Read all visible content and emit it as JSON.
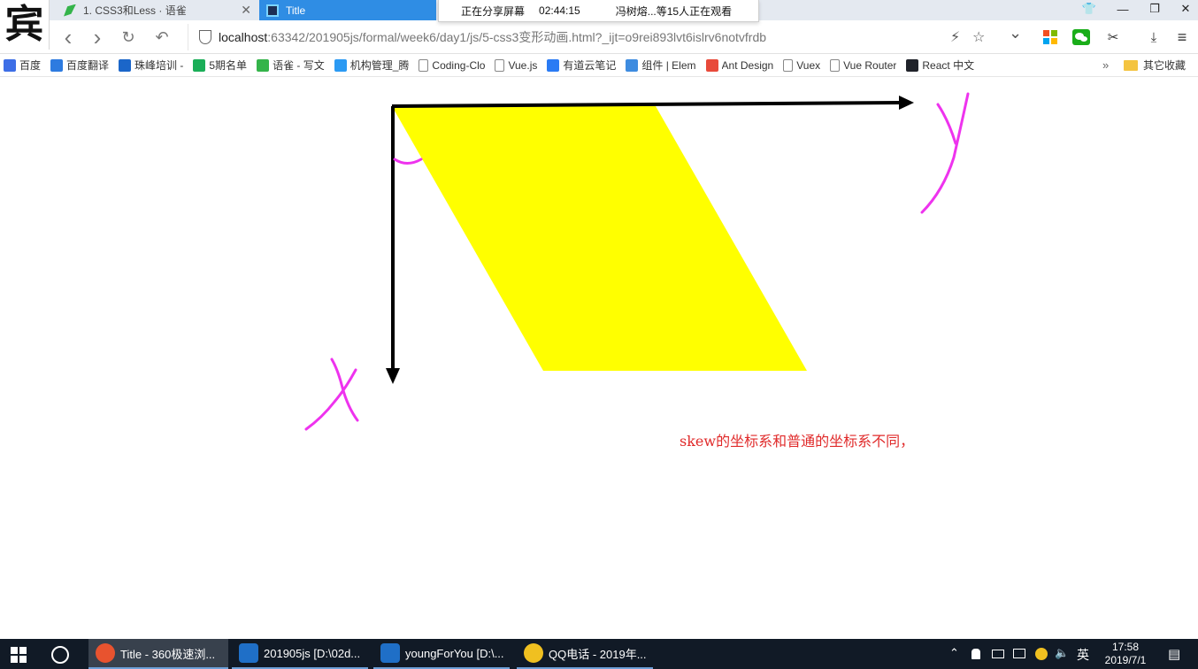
{
  "window": {
    "logo_char": "宾",
    "tabs": [
      {
        "label": "1. CSS3和Less · 语雀",
        "close": "✕"
      },
      {
        "label": "Title"
      }
    ],
    "screen_share": {
      "status": "正在分享屏幕",
      "timer": "02:44:15",
      "viewers": "冯树熔...等15人正在观看"
    },
    "controls": {
      "skin": "👕",
      "minimize": "—",
      "restore": "❐",
      "close": "✕"
    }
  },
  "navbar": {
    "back": "‹",
    "forward": "›",
    "reload": "↻",
    "undo": "↶",
    "url_host": "localhost",
    "url_path": ":63342/201905js/formal/week6/day1/js/5-css3变形动画.html?_ijt=o9rei893lvt6islrv6notvfrdb",
    "lightning": "⚡",
    "star": "☆",
    "dropdown": "⌄",
    "scissors": "✂",
    "download": "⤓",
    "menu": "≡"
  },
  "bookmarks": [
    {
      "label": "百度",
      "color": "#3d6ee6"
    },
    {
      "label": "百度翻译",
      "color": "#2d7be0"
    },
    {
      "label": "珠峰培训 -",
      "color": "#1b66c9"
    },
    {
      "label": "5期名单",
      "color": "#1aae58"
    },
    {
      "label": "语雀 - 写文",
      "color": "#34b44a"
    },
    {
      "label": "机构管理_腾",
      "color": "#2b9af3"
    },
    {
      "label": "Coding-Clo",
      "color": "#ffffff"
    },
    {
      "label": "Vue.js",
      "color": "#ffffff"
    },
    {
      "label": "有道云笔记",
      "color": "#2a7bf4"
    },
    {
      "label": "组件 | Elem",
      "color": "#3e8ce0"
    },
    {
      "label": "Ant Design",
      "color": "#e84a3a"
    },
    {
      "label": "Vuex",
      "color": "#ffffff"
    },
    {
      "label": "Vue Router",
      "color": "#ffffff"
    },
    {
      "label": "React 中文",
      "color": "#20232a"
    }
  ],
  "bookmarks_more": "»",
  "bookmarks_other": "其它收藏",
  "page": {
    "note": "skew的坐标系和普通的坐标系不同，",
    "shape_color": "#ffff00",
    "annotation_color": "#ee33ee",
    "axis_color": "#000000",
    "skew_angle_deg": 30
  },
  "taskbar": {
    "items": [
      {
        "label": "Title - 360极速浏...",
        "icon_color": "#e8532f"
      },
      {
        "label": "201905js [D:\\02d...",
        "icon_color": "#1f6fc7"
      },
      {
        "label": "youngForYou [D:\\...",
        "icon_color": "#1f6fc7"
      },
      {
        "label": "QQ电话 - 2019年...",
        "icon_color": "#f0c020"
      }
    ],
    "tray_caret": "⌃",
    "ime": "英",
    "volume": "🔈",
    "time": "17:58",
    "date": "2019/7/1",
    "notify": "▤"
  }
}
